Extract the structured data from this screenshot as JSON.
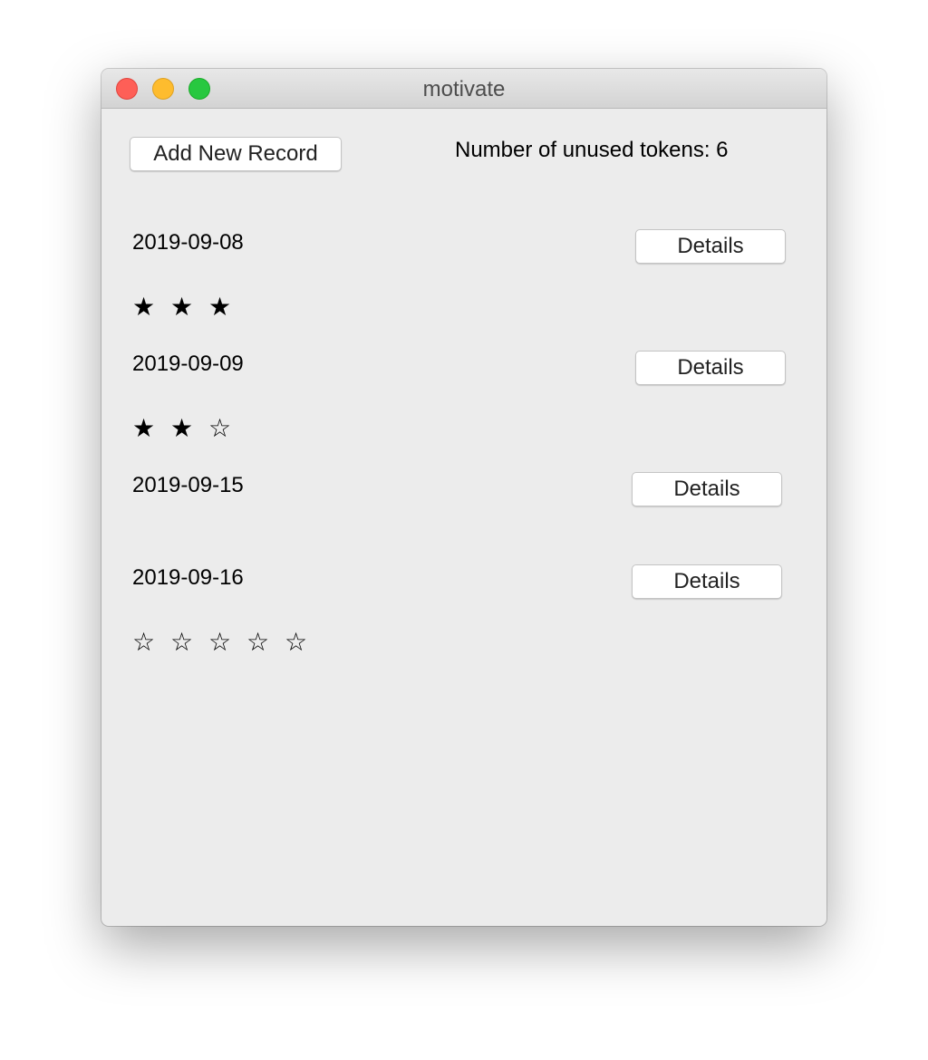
{
  "window": {
    "title": "motivate"
  },
  "toolbar": {
    "add_label": "Add New Record",
    "tokens_label": "Number of unused tokens: 6"
  },
  "records": [
    {
      "date": "2019-09-08",
      "details": "Details",
      "stars": [
        "★",
        "★",
        "★"
      ]
    },
    {
      "date": "2019-09-09",
      "details": "Details",
      "stars": [
        "★",
        "★",
        "☆"
      ]
    },
    {
      "date": "2019-09-15",
      "details": "Details",
      "stars": []
    },
    {
      "date": "2019-09-16",
      "details": "Details",
      "stars": [
        "☆",
        "☆",
        "☆",
        "☆",
        "☆"
      ]
    }
  ]
}
